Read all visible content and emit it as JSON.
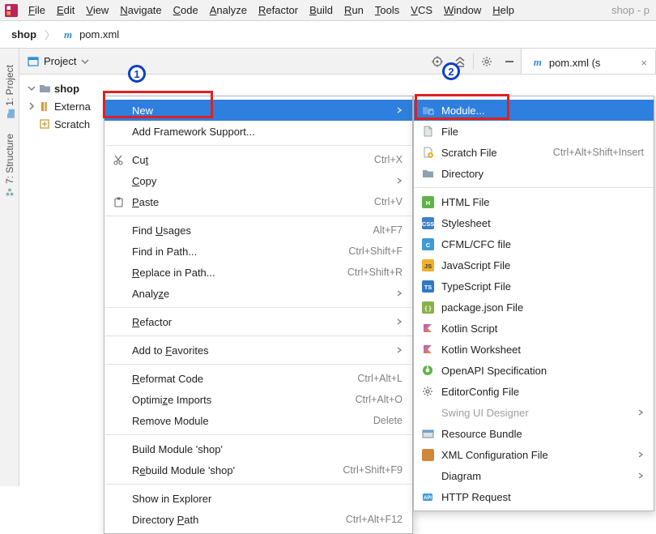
{
  "app_title_right": "shop - p",
  "menubar": [
    "File",
    "Edit",
    "View",
    "Navigate",
    "Code",
    "Analyze",
    "Refactor",
    "Build",
    "Run",
    "Tools",
    "VCS",
    "Window",
    "Help"
  ],
  "menubar_mnemonic": [
    "F",
    "E",
    "V",
    "N",
    "C",
    "A",
    "R",
    "B",
    "R",
    "T",
    "V",
    "W",
    "H"
  ],
  "breadcrumb": {
    "root": "shop",
    "file": "pom.xml"
  },
  "proj_toggle": {
    "label": "Project"
  },
  "editor_tab": {
    "label": "pom.xml (s"
  },
  "tree": {
    "root": "shop",
    "external": "Externa",
    "scratches": "Scratch"
  },
  "side_tabs": {
    "project": "1: Project",
    "structure": "7: Structure"
  },
  "badges": {
    "one": "1",
    "two": "2"
  },
  "ctx1": [
    {
      "label": "New",
      "selected": true,
      "submenu": true
    },
    {
      "label": "Add Framework Support..."
    },
    {
      "sep": true
    },
    {
      "label": "Cut",
      "u": "t",
      "sc": "Ctrl+X",
      "icon": "cut"
    },
    {
      "label": "Copy",
      "u": "C",
      "submenu": true
    },
    {
      "label": "Paste",
      "u": "P",
      "sc": "Ctrl+V",
      "icon": "paste"
    },
    {
      "sep": true
    },
    {
      "label": "Find Usages",
      "u": "U",
      "sc": "Alt+F7"
    },
    {
      "label": "Find in Path...",
      "sc": "Ctrl+Shift+F"
    },
    {
      "label": "Replace in Path...",
      "u": "R",
      "sc": "Ctrl+Shift+R"
    },
    {
      "label": "Analyze",
      "u": "z",
      "submenu": true
    },
    {
      "sep": true
    },
    {
      "label": "Refactor",
      "u": "R",
      "submenu": true
    },
    {
      "sep": true
    },
    {
      "label": "Add to Favorites",
      "u": "F",
      "submenu": true
    },
    {
      "sep": true
    },
    {
      "label": "Reformat Code",
      "u": "R",
      "sc": "Ctrl+Alt+L"
    },
    {
      "label": "Optimize Imports",
      "u": "z",
      "sc": "Ctrl+Alt+O"
    },
    {
      "label": "Remove Module",
      "sc": "Delete"
    },
    {
      "sep": true
    },
    {
      "label": "Build Module 'shop'"
    },
    {
      "label": "Rebuild Module 'shop'",
      "u": "e",
      "sc": "Ctrl+Shift+F9"
    },
    {
      "sep": true
    },
    {
      "label": "Show in Explorer"
    },
    {
      "label": "Directory Path",
      "u": "P",
      "sc": "Ctrl+Alt+F12"
    }
  ],
  "ctx2": [
    {
      "label": "Module...",
      "selected": true,
      "icon": "module"
    },
    {
      "label": "File",
      "icon": "file"
    },
    {
      "label": "Scratch File",
      "icon": "scratch",
      "sc": "Ctrl+Alt+Shift+Insert"
    },
    {
      "label": "Directory",
      "icon": "folder"
    },
    {
      "sep": true
    },
    {
      "label": "HTML File",
      "icon": "html"
    },
    {
      "label": "Stylesheet",
      "icon": "css"
    },
    {
      "label": "CFML/CFC file",
      "icon": "cf"
    },
    {
      "label": "JavaScript File",
      "icon": "js"
    },
    {
      "label": "TypeScript File",
      "icon": "ts"
    },
    {
      "label": "package.json File",
      "icon": "pkg"
    },
    {
      "label": "Kotlin Script",
      "icon": "kotlin"
    },
    {
      "label": "Kotlin Worksheet",
      "icon": "kotlin"
    },
    {
      "label": "OpenAPI Specification",
      "icon": "openapi"
    },
    {
      "label": "EditorConfig File",
      "icon": "gear"
    },
    {
      "label": "Swing UI Designer",
      "disabled": true,
      "submenu": true
    },
    {
      "label": "Resource Bundle",
      "icon": "bundle"
    },
    {
      "label": "XML Configuration File",
      "icon": "xml",
      "submenu": true
    },
    {
      "label": "Diagram",
      "submenu": true
    },
    {
      "label": "HTTP Request",
      "icon": "http"
    }
  ]
}
